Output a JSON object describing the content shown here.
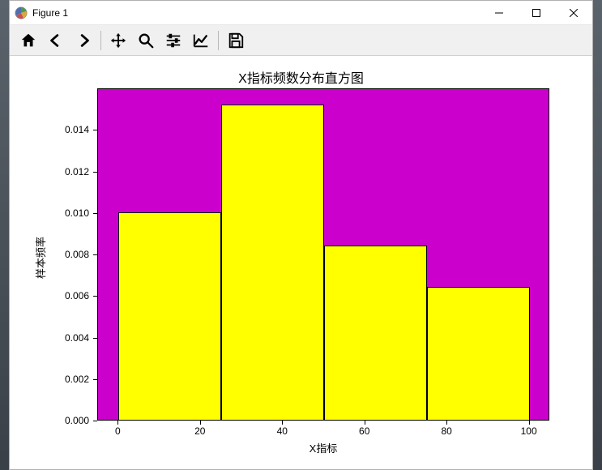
{
  "window": {
    "title": "Figure 1"
  },
  "toolbar": {
    "home": "Home",
    "back": "Back",
    "forward": "Forward",
    "pan": "Pan",
    "zoom": "Zoom",
    "configure": "Configure subplots",
    "edit": "Edit axis",
    "save": "Save"
  },
  "chart_data": {
    "type": "bar",
    "title": "X指标频数分布直方图",
    "xlabel": "X指标",
    "ylabel": "样本频率",
    "xlim": [
      -5,
      105
    ],
    "ylim": [
      0.0,
      0.016
    ],
    "xticks": [
      0,
      20,
      40,
      60,
      80,
      100
    ],
    "yticks": [
      0.0,
      0.002,
      0.004,
      0.006,
      0.008,
      0.01,
      0.012,
      0.014
    ],
    "ytick_labels": [
      "0.000",
      "0.002",
      "0.004",
      "0.006",
      "0.008",
      "0.010",
      "0.012",
      "0.014"
    ],
    "bin_edges": [
      0,
      25,
      50,
      75,
      100
    ],
    "values": [
      0.01,
      0.0152,
      0.0084,
      0.0064
    ],
    "bar_color": "#ffff00",
    "bg_color": "#cc00cc"
  }
}
